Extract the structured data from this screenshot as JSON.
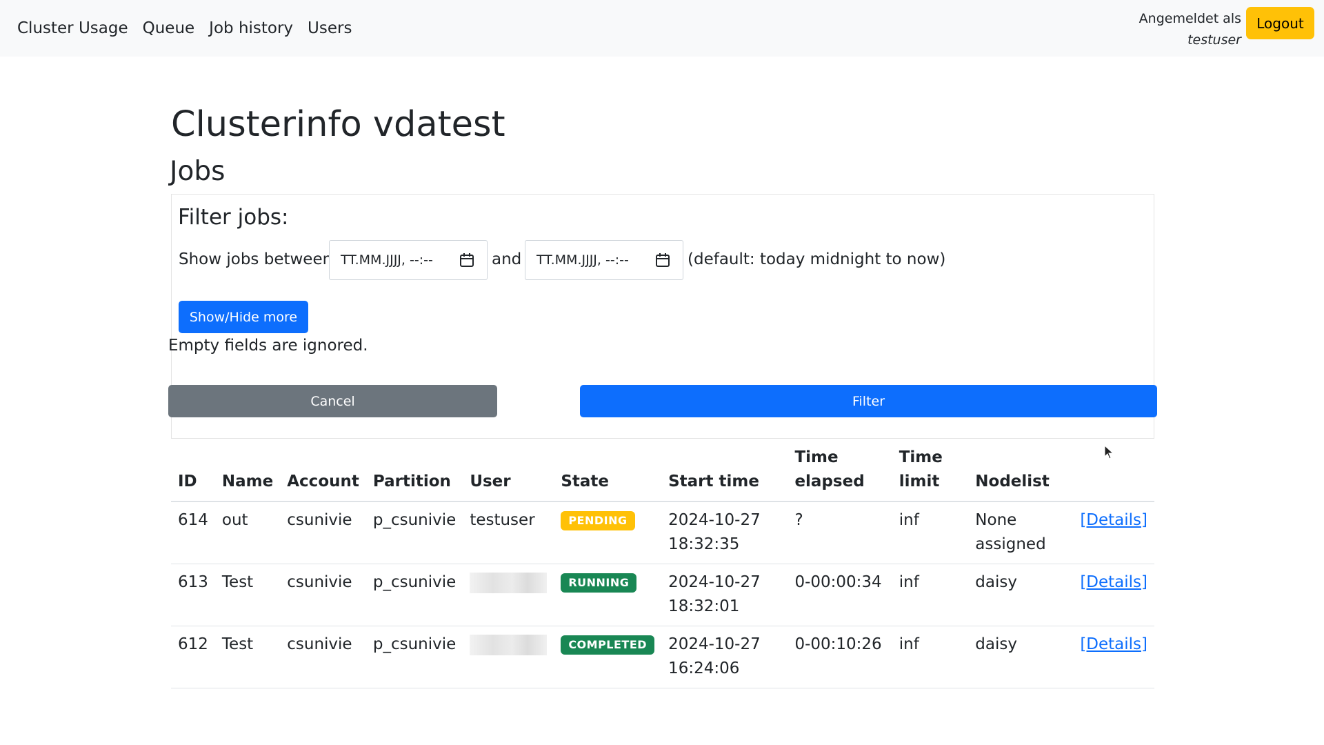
{
  "nav": {
    "links": [
      "Cluster Usage",
      "Queue",
      "Job history",
      "Users"
    ],
    "login_label": "Angemeldet als",
    "login_user": "testuser",
    "logout_label": "Logout"
  },
  "page": {
    "title": "Clusterinfo vdatest",
    "section": "Jobs"
  },
  "filter": {
    "heading": "Filter jobs:",
    "between_label": "Show jobs between",
    "and_label": "and",
    "default_note": "(default: today midnight to now)",
    "date_placeholder": "TT.MM.JJJJ, --:--",
    "show_hide_label": "Show/Hide more",
    "empty_note": "Empty fields are ignored.",
    "cancel_label": "Cancel",
    "filter_label": "Filter"
  },
  "table": {
    "headers": [
      "ID",
      "Name",
      "Account",
      "Partition",
      "User",
      "State",
      "Start time",
      "Time elapsed",
      "Time limit",
      "Nodelist",
      ""
    ],
    "rows": [
      {
        "id": "614",
        "name": "out",
        "account": "csunivie",
        "partition": "p_csunivie",
        "user": "testuser",
        "state": "PENDING",
        "start_date": "2024-10-27",
        "start_time": "18:32:35",
        "elapsed": "?",
        "limit": "inf",
        "nodelist": "None assigned",
        "details": "[Details]"
      },
      {
        "id": "613",
        "name": "Test",
        "account": "csunivie",
        "partition": "p_csunivie",
        "user": "",
        "state": "RUNNING",
        "start_date": "2024-10-27",
        "start_time": "18:32:01",
        "elapsed": "0-00:00:34",
        "limit": "inf",
        "nodelist": "daisy",
        "details": "[Details]"
      },
      {
        "id": "612",
        "name": "Test",
        "account": "csunivie",
        "partition": "p_csunivie",
        "user": "",
        "state": "COMPLETED",
        "start_date": "2024-10-27",
        "start_time": "16:24:06",
        "elapsed": "0-00:10:26",
        "limit": "inf",
        "nodelist": "daisy",
        "details": "[Details]"
      }
    ]
  },
  "colors": {
    "primary": "#0d6efd",
    "secondary": "#6c757d",
    "warning": "#ffc107",
    "success": "#198754"
  }
}
